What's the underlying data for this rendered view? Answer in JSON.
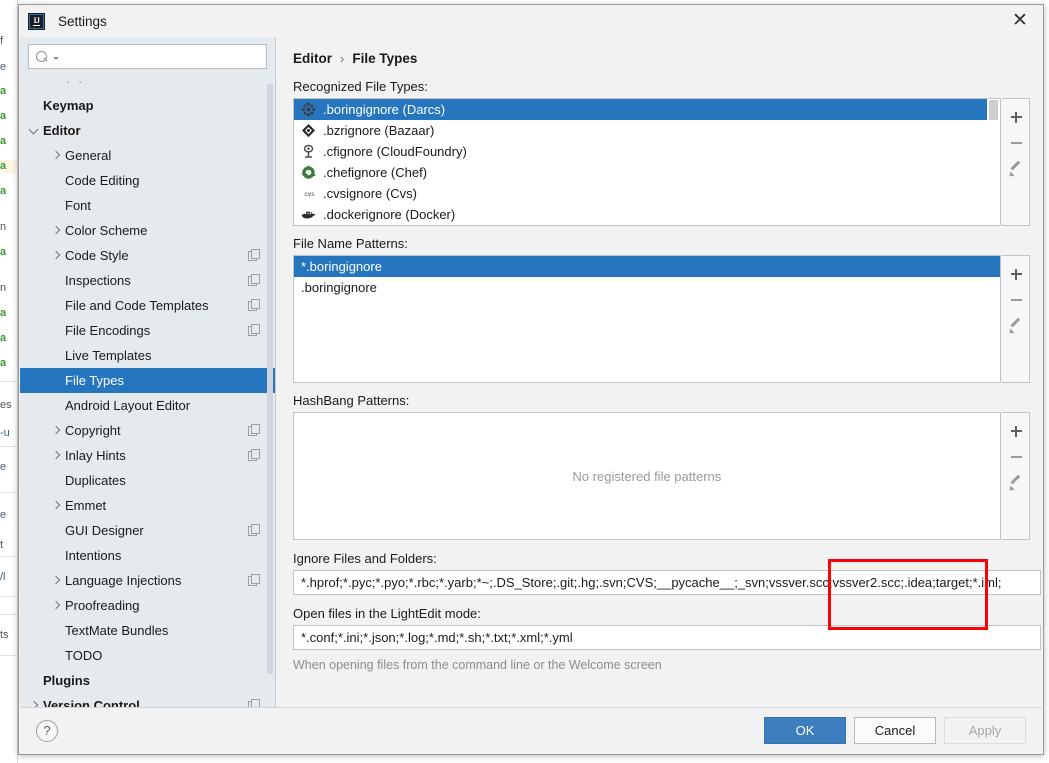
{
  "window": {
    "title": "Settings",
    "logo_icon": "intellij-logo-icon",
    "close_icon": "close-icon"
  },
  "sidebar": {
    "search": {
      "placeholder": "",
      "value": "",
      "icon": "search-icon"
    },
    "items": [
      {
        "label": "Keymap",
        "indent": 0,
        "arrow": "none",
        "bold": true,
        "config": false,
        "selected": false
      },
      {
        "label": "Editor",
        "indent": 0,
        "arrow": "down",
        "bold": true,
        "config": false,
        "selected": false
      },
      {
        "label": "General",
        "indent": 1,
        "arrow": "right",
        "bold": false,
        "config": false,
        "selected": false
      },
      {
        "label": "Code Editing",
        "indent": 1,
        "arrow": "none",
        "bold": false,
        "config": false,
        "selected": false
      },
      {
        "label": "Font",
        "indent": 1,
        "arrow": "none",
        "bold": false,
        "config": false,
        "selected": false
      },
      {
        "label": "Color Scheme",
        "indent": 1,
        "arrow": "right",
        "bold": false,
        "config": false,
        "selected": false
      },
      {
        "label": "Code Style",
        "indent": 1,
        "arrow": "right",
        "bold": false,
        "config": true,
        "selected": false
      },
      {
        "label": "Inspections",
        "indent": 1,
        "arrow": "none",
        "bold": false,
        "config": true,
        "selected": false
      },
      {
        "label": "File and Code Templates",
        "indent": 1,
        "arrow": "none",
        "bold": false,
        "config": true,
        "selected": false
      },
      {
        "label": "File Encodings",
        "indent": 1,
        "arrow": "none",
        "bold": false,
        "config": true,
        "selected": false
      },
      {
        "label": "Live Templates",
        "indent": 1,
        "arrow": "none",
        "bold": false,
        "config": false,
        "selected": false
      },
      {
        "label": "File Types",
        "indent": 1,
        "arrow": "none",
        "bold": false,
        "config": false,
        "selected": true
      },
      {
        "label": "Android Layout Editor",
        "indent": 1,
        "arrow": "none",
        "bold": false,
        "config": false,
        "selected": false
      },
      {
        "label": "Copyright",
        "indent": 1,
        "arrow": "right",
        "bold": false,
        "config": true,
        "selected": false
      },
      {
        "label": "Inlay Hints",
        "indent": 1,
        "arrow": "right",
        "bold": false,
        "config": true,
        "selected": false
      },
      {
        "label": "Duplicates",
        "indent": 1,
        "arrow": "none",
        "bold": false,
        "config": false,
        "selected": false
      },
      {
        "label": "Emmet",
        "indent": 1,
        "arrow": "right",
        "bold": false,
        "config": false,
        "selected": false
      },
      {
        "label": "GUI Designer",
        "indent": 1,
        "arrow": "none",
        "bold": false,
        "config": true,
        "selected": false
      },
      {
        "label": "Intentions",
        "indent": 1,
        "arrow": "none",
        "bold": false,
        "config": false,
        "selected": false
      },
      {
        "label": "Language Injections",
        "indent": 1,
        "arrow": "right",
        "bold": false,
        "config": true,
        "selected": false
      },
      {
        "label": "Proofreading",
        "indent": 1,
        "arrow": "right",
        "bold": false,
        "config": false,
        "selected": false
      },
      {
        "label": "TextMate Bundles",
        "indent": 1,
        "arrow": "none",
        "bold": false,
        "config": false,
        "selected": false
      },
      {
        "label": "TODO",
        "indent": 1,
        "arrow": "none",
        "bold": false,
        "config": false,
        "selected": false
      },
      {
        "label": "Plugins",
        "indent": 0,
        "arrow": "none",
        "bold": true,
        "config": false,
        "selected": false
      },
      {
        "label": "Version Control",
        "indent": 0,
        "arrow": "right",
        "bold": true,
        "config": true,
        "selected": false
      }
    ]
  },
  "breadcrumb": {
    "parent": "Editor",
    "separator": "›",
    "current": "File Types"
  },
  "recognized_file_types": {
    "label": "Recognized File Types:",
    "rows": [
      {
        "text": ".boringignore (Darcs)",
        "icon": "darcs-icon",
        "selected": true
      },
      {
        "text": ".bzrignore (Bazaar)",
        "icon": "bazaar-icon",
        "selected": false
      },
      {
        "text": ".cfignore (CloudFoundry)",
        "icon": "cloudfoundry-icon",
        "selected": false
      },
      {
        "text": ".chefignore (Chef)",
        "icon": "chef-icon",
        "selected": false
      },
      {
        "text": ".cvsignore (Cvs)",
        "icon": "cvs-icon",
        "selected": false
      },
      {
        "text": ".dockerignore (Docker)",
        "icon": "docker-icon",
        "selected": false
      }
    ],
    "toolbar": {
      "add": "+",
      "remove": "−",
      "edit": "pencil-icon"
    }
  },
  "file_name_patterns": {
    "label": "File Name Patterns:",
    "rows": [
      {
        "text": "*.boringignore",
        "selected": true
      },
      {
        "text": ".boringignore",
        "selected": false
      }
    ],
    "toolbar": {
      "add": "+",
      "remove": "−",
      "edit": "pencil-icon"
    }
  },
  "hashbang_patterns": {
    "label": "HashBang Patterns:",
    "empty_text": "No registered file patterns",
    "toolbar": {
      "add": "+",
      "remove": "−",
      "edit": "pencil-icon"
    }
  },
  "ignore_files": {
    "label": "Ignore Files and Folders:",
    "value": "*.hprof;*.pyc;*.pyo;*.rbc;*.yarb;*~;.DS_Store;.git;.hg;.svn;CVS;__pycache__;_svn;vssver.scc;vssver2.scc;.idea;target;*.iml;"
  },
  "lightedit": {
    "label": "Open files in the LightEdit mode:",
    "value": "*.conf;*.ini;*.json;*.log;*.md;*.sh;*.txt;*.xml;*.yml",
    "hint": "When opening files from the command line or the Welcome screen"
  },
  "footer": {
    "help": "?",
    "ok": "OK",
    "cancel": "Cancel",
    "apply": "Apply"
  },
  "annotation": {
    "highlight_color": "#fb0007"
  },
  "ide_background": {
    "fragments": [
      "f",
      "e",
      "a",
      "a",
      "a",
      "a",
      "a",
      "n",
      "a",
      "n",
      "a",
      "a",
      "a",
      "es",
      "-u",
      "e",
      "e",
      "t",
      "/l",
      "ts"
    ]
  }
}
